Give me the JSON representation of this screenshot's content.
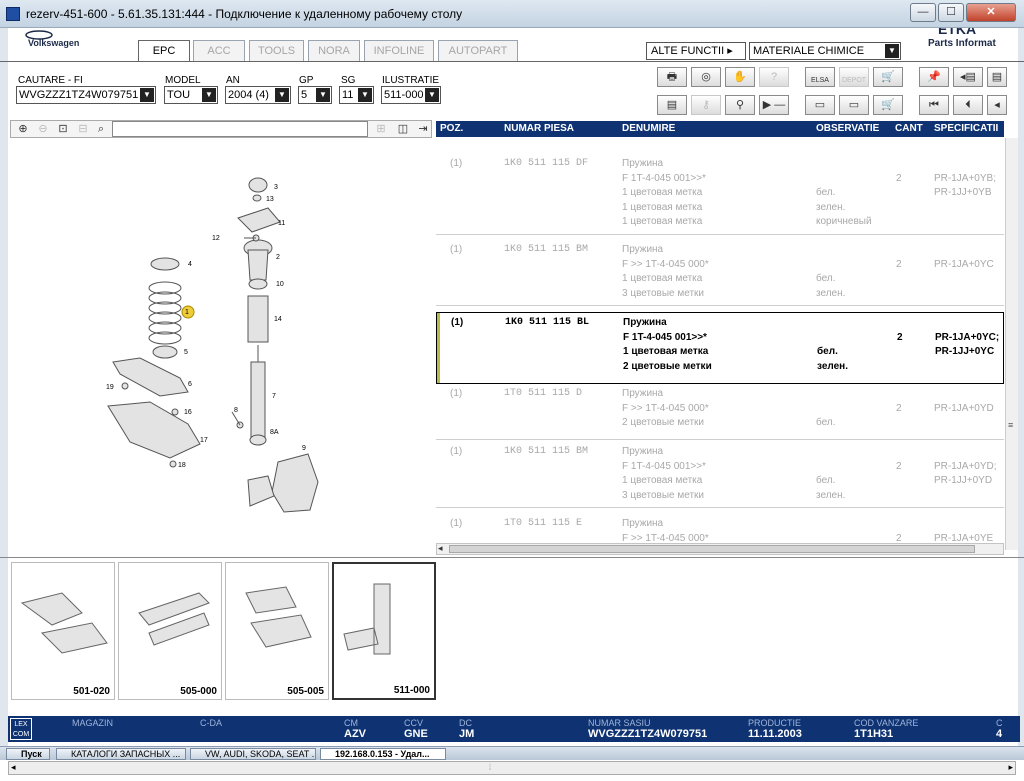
{
  "window": {
    "title": "rezerv-451-600 - 5.61.35.131:444 - Подключение к удаленному рабочему столу",
    "btn_min": "—",
    "btn_max": "☐",
    "btn_close": "✕"
  },
  "header": {
    "brand": "Volkswagen",
    "logo_text": "ETKA",
    "logo_sub": "Parts Informat",
    "tabs": [
      {
        "label": "EPC",
        "active": true
      },
      {
        "label": "ACC",
        "active": false
      },
      {
        "label": "TOOLS",
        "active": false
      },
      {
        "label": "NORA",
        "active": false
      },
      {
        "label": "INFOLINE",
        "active": false
      },
      {
        "label": "AUTOPART",
        "active": false
      }
    ],
    "alte_functii": "ALTE FUNCTII ▸",
    "materiale": "MATERIALE CHIMICE"
  },
  "filters": {
    "cautare_label": "CAUTARE - FI",
    "cautare_value": "WVGZZZ1TZ4W079751",
    "model_label": "MODEL",
    "model_value": "TOU",
    "an_label": "AN",
    "an_value": "2004 (4)",
    "gp_label": "GP",
    "gp_value": "5",
    "sg_label": "SG",
    "sg_value": "11",
    "ilustratie_label": "ILUSTRATIE",
    "ilustratie_value": "511-000"
  },
  "toolbar_icons": {
    "print": "print-icon",
    "elsa_label": "ELSA",
    "depot_label": "DEPOT"
  },
  "table": {
    "headers": {
      "poz": "POZ.",
      "numar": "NUMAR PIESA",
      "denumire": "DENUMIRE",
      "observatie": "OBSERVATIE",
      "cant": "CANT",
      "spec": "SPECIFICATII"
    },
    "rows": [
      {
        "poz": "(1)",
        "numar": "1K0 511 115 DF",
        "cant": "2",
        "selected": false,
        "lines": [
          {
            "den": "Пружина",
            "obs": "",
            "spec": ""
          },
          {
            "den": "F 1T-4-045 001>>*",
            "obs": "",
            "spec": "PR-1JA+0YB;"
          },
          {
            "den": "1 цветовая метка",
            "obs": "бел.",
            "spec": "PR-1JJ+0YB"
          },
          {
            "den": "1 цветовая метка",
            "obs": "зелен.",
            "spec": ""
          },
          {
            "den": "1 цветовая метка",
            "obs": "коричневый",
            "spec": ""
          }
        ]
      },
      {
        "poz": "(1)",
        "numar": "1K0 511 115 BM",
        "cant": "2",
        "selected": false,
        "lines": [
          {
            "den": "Пружина",
            "obs": "",
            "spec": ""
          },
          {
            "den": "F           >> 1T-4-045 000*",
            "obs": "",
            "spec": "PR-1JA+0YC"
          },
          {
            "den": "1 цветовая метка",
            "obs": "бел.",
            "spec": ""
          },
          {
            "den": "3 цветовые метки",
            "obs": "зелен.",
            "spec": ""
          }
        ]
      },
      {
        "poz": "(1)",
        "numar": "1K0 511 115 BL",
        "cant": "2",
        "selected": true,
        "lines": [
          {
            "den": "Пружина",
            "obs": "",
            "spec": ""
          },
          {
            "den": "F 1T-4-045 001>>*",
            "obs": "",
            "spec": "PR-1JA+0YC;"
          },
          {
            "den": "1 цветовая метка",
            "obs": "бел.",
            "spec": "PR-1JJ+0YC"
          },
          {
            "den": "2 цветовые метки",
            "obs": "зелен.",
            "spec": ""
          }
        ]
      },
      {
        "poz": "(1)",
        "numar": "1T0 511 115 D",
        "cant": "2",
        "selected": false,
        "lines": [
          {
            "den": "Пружина",
            "obs": "",
            "spec": ""
          },
          {
            "den": "F           >> 1T-4-045 000*",
            "obs": "",
            "spec": "PR-1JA+0YD"
          },
          {
            "den": "2 цветовые метки",
            "obs": "бел.",
            "spec": ""
          }
        ]
      },
      {
        "poz": "(1)",
        "numar": "1K0 511 115 BM",
        "cant": "2",
        "selected": false,
        "lines": [
          {
            "den": "Пружина",
            "obs": "",
            "spec": ""
          },
          {
            "den": "F 1T-4-045 001>>*",
            "obs": "",
            "spec": "PR-1JA+0YD;"
          },
          {
            "den": "1 цветовая метка",
            "obs": "бел.",
            "spec": "PR-1JJ+0YD"
          },
          {
            "den": "3 цветовые метки",
            "obs": "зелен.",
            "spec": ""
          }
        ]
      },
      {
        "poz": "(1)",
        "numar": "1T0 511 115 E",
        "cant": "2",
        "selected": false,
        "lines": [
          {
            "den": "Пружина",
            "obs": "",
            "spec": ""
          },
          {
            "den": "F           >> 1T-4-045 000*",
            "obs": "",
            "spec": "PR-1JA+0YE"
          }
        ]
      }
    ]
  },
  "illustration": {
    "callouts": [
      "3",
      "13",
      "11",
      "12",
      "2",
      "4",
      "10",
      "1",
      "14",
      "5",
      "7",
      "6",
      "19",
      "16",
      "8",
      "8A",
      "17",
      "9",
      "18"
    ]
  },
  "thumbnails": [
    {
      "label": "501-020",
      "active": false
    },
    {
      "label": "505-000",
      "active": false
    },
    {
      "label": "505-005",
      "active": false
    },
    {
      "label": "511-000",
      "active": true
    }
  ],
  "status": {
    "lexcom": "LEX COM",
    "magazin_label": "MAGAZIN",
    "cda_label": "C-DA",
    "cm_label": "CM",
    "cm_value": "AZV",
    "ccv_label": "CCV",
    "ccv_value": "GNE",
    "dc_label": "DC",
    "dc_value": "JM",
    "sasiu_label": "NUMAR SASIU",
    "sasiu_value": "WVGZZZ1TZ4W079751",
    "productie_label": "PRODUCTIE",
    "productie_value": "11.11.2003",
    "vanzare_label": "COD VANZARE",
    "vanzare_value": "1T1H31",
    "extra_label": "C",
    "extra_value": "4"
  },
  "taskbar": {
    "items": [
      "Пуск",
      "КАТАЛОГИ ЗАПАСНЫХ ...",
      "VW, AUDI, SKODA, SEAT ...",
      "192.168.0.153 - Удал..."
    ]
  }
}
